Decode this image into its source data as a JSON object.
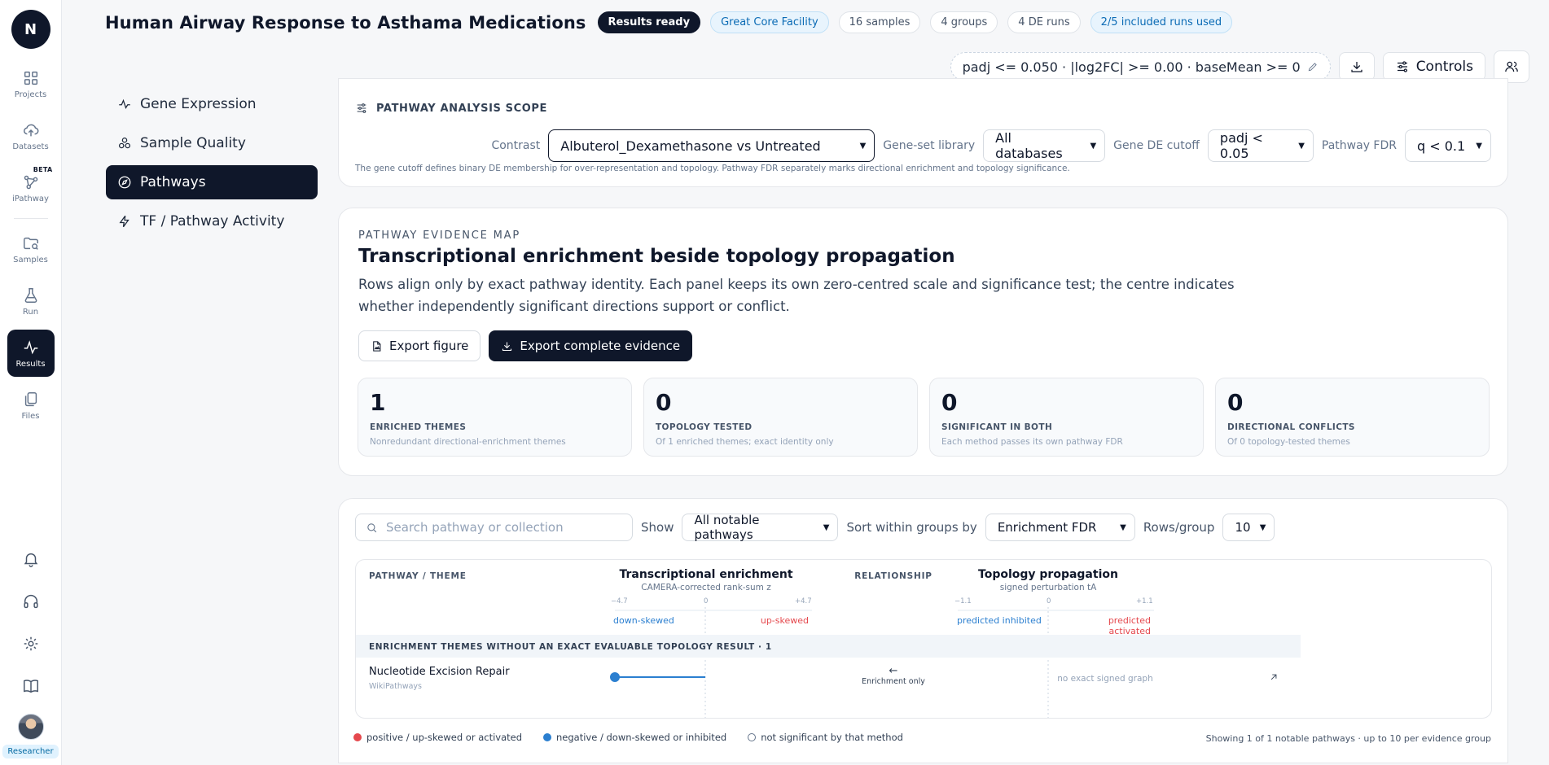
{
  "brand": {
    "logo_letter": "N"
  },
  "rail": {
    "items": [
      {
        "label": "Projects",
        "icon": "grid-icon"
      },
      {
        "label": "Datasets",
        "icon": "cloud-upload-icon"
      },
      {
        "label": "iPathway",
        "icon": "network-icon",
        "badge": "BETA"
      },
      {
        "label": "Samples",
        "icon": "folder-search-icon"
      },
      {
        "label": "Run",
        "icon": "flask-icon"
      },
      {
        "label": "Results",
        "icon": "activity-icon"
      },
      {
        "label": "Files",
        "icon": "files-icon"
      }
    ],
    "role": "Researcher"
  },
  "header": {
    "title": "Human Airway Response to Asthama Medications",
    "chips": [
      "Results ready",
      "Great Core Facility",
      "16 samples",
      "4 groups",
      "4 DE runs",
      "2/5 included runs used"
    ],
    "filter_summary": "padj <= 0.050 · |log2FC| >= 0.00 · baseMean >= 0",
    "controls_label": "Controls"
  },
  "subnav": {
    "items": [
      "Gene Expression",
      "Sample Quality",
      "Pathways",
      "TF / Pathway Activity"
    ],
    "active": "Pathways"
  },
  "scope": {
    "heading": "PATHWAY ANALYSIS SCOPE",
    "contrast_label": "Contrast",
    "contrast_value": "Albuterol_Dexamethasone vs Untreated",
    "library_label": "Gene-set library",
    "library_value": "All databases",
    "cutoff_label": "Gene DE cutoff",
    "cutoff_value": "padj < 0.05",
    "fdr_label": "Pathway FDR",
    "fdr_value": "q < 0.1",
    "note": "The gene cutoff defines binary DE membership for over-representation and topology. Pathway FDR separately marks directional enrichment and topology significance."
  },
  "evidence": {
    "eyebrow": "PATHWAY EVIDENCE MAP",
    "title": "Transcriptional enrichment beside topology propagation",
    "description": "Rows align only by exact pathway identity. Each panel keeps its own zero-centred scale and significance test; the centre indicates whether independently significant directions support or conflict.",
    "export_figure": "Export figure",
    "export_evidence": "Export complete evidence",
    "stats": [
      {
        "value": "1",
        "label": "ENRICHED THEMES",
        "sub": "Nonredundant directional-enrichment themes"
      },
      {
        "value": "0",
        "label": "TOPOLOGY TESTED",
        "sub": "Of 1 enriched themes; exact identity only"
      },
      {
        "value": "0",
        "label": "SIGNIFICANT IN BOTH",
        "sub": "Each method passes its own pathway FDR"
      },
      {
        "value": "0",
        "label": "DIRECTIONAL CONFLICTS",
        "sub": "Of 0 topology-tested themes"
      }
    ]
  },
  "table": {
    "search_placeholder": "Search pathway or collection",
    "show_label": "Show",
    "show_value": "All notable pathways",
    "sort_label": "Sort within groups by",
    "sort_value": "Enrichment FDR",
    "rows_label": "Rows/group",
    "rows_value": "10",
    "col_pathway": "PATHWAY / THEME",
    "col_relationship": "RELATIONSHIP",
    "enrichment": {
      "title": "Transcriptional enrichment",
      "subtitle": "CAMERA-corrected rank-sum z",
      "ticks": [
        "−4.7",
        "0",
        "+4.7"
      ],
      "min": -4.7,
      "max": 4.7,
      "neg_label": "down-skewed",
      "pos_label": "up-skewed"
    },
    "topology": {
      "title": "Topology propagation",
      "subtitle": "signed perturbation tA",
      "ticks": [
        "−1.1",
        "0",
        "+1.1"
      ],
      "neg_label": "predicted inhibited",
      "pos_label": "predicted activated"
    },
    "group_heading": "ENRICHMENT THEMES WITHOUT AN EXACT EVALUABLE TOPOLOGY RESULT · 1",
    "rows": [
      {
        "name": "Nucleotide Excision Repair",
        "collection": "WikiPathways",
        "enrichment_z": -4.7,
        "relationship_arrow": "←",
        "relationship": "Enrichment only",
        "topology_text": "no exact signed graph"
      }
    ],
    "legend": [
      {
        "text": "positive / up-skewed or activated",
        "color": "#e5484d"
      },
      {
        "text": "negative / down-skewed or inhibited",
        "color": "#2b7fd0"
      },
      {
        "text": "not significant by that method",
        "color": "#ffffff"
      }
    ],
    "footer": "Showing 1 of 1 notable pathways · up to 10 per evidence group"
  },
  "colors": {
    "accent": "#0f172a",
    "positive": "#e5484d",
    "negative": "#2b7fd0",
    "info": "#0b6bb5"
  }
}
